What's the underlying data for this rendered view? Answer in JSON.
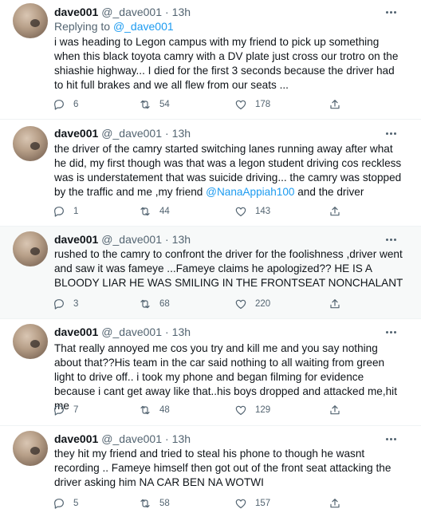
{
  "tweets": [
    {
      "name": "dave001",
      "handle": "@_dave001",
      "sep": "·",
      "time": "13h",
      "reply_prefix": "Replying to",
      "reply_to": "@_dave001",
      "text": "i was heading to Legon campus with my friend to pick up something when this black toyota camry with a DV plate just cross our trotro on the shiashie highway... I died for the first 3 seconds because the driver had to hit full brakes and we all flew from our seats ...",
      "replies": "6",
      "retweets": "54",
      "likes": "178"
    },
    {
      "name": "dave001",
      "handle": "@_dave001",
      "sep": "·",
      "time": "13h",
      "text": "the driver of the camry started switching lanes running away after what he did, my first though was that was a legon student driving cos reckless was is understatement that was suicide driving... the camry was stopped by the traffic and me ,my friend",
      "mention": "@NanaAppiah100",
      "text_after": " and the driver",
      "replies": "1",
      "retweets": "44",
      "likes": "143"
    },
    {
      "name": "dave001",
      "handle": "@_dave001",
      "sep": "·",
      "time": "13h",
      "text": "rushed to the camry to confront the driver for the foolishness ,driver went and saw it was fameye ...Fameye claims he apologized?? HE IS A BLOODY LIAR HE WAS SMILING IN THE FRONTSEAT NONCHALANT",
      "replies": "3",
      "retweets": "68",
      "likes": "220"
    },
    {
      "name": "dave001",
      "handle": "@_dave001",
      "sep": "·",
      "time": "13h",
      "text": "That really annoyed me cos you try and kill me and you say nothing about that??His team in the car said nothing to all waiting from green light to drive off.. i took my phone and began filming for evidence because i cant get away like that..his boys dropped and attacked me,hit me",
      "replies": "7",
      "retweets": "48",
      "likes": "129"
    },
    {
      "name": "dave001",
      "handle": "@_dave001",
      "sep": "·",
      "time": "13h",
      "text": "they hit my friend and tried to steal his phone to though he wasnt recording .. Fameye himself then got out of the front seat attacking the driver asking him NA CAR BEN NA WOTWI",
      "replies": "5",
      "retweets": "58",
      "likes": "157"
    }
  ],
  "colors": {
    "text": "#0f1419",
    "secondary": "#536471",
    "link": "#1d9bf0",
    "shaded_bg": "#f7f9f9"
  },
  "icons": [
    "more-icon",
    "reply-icon",
    "retweet-icon",
    "like-icon",
    "share-icon"
  ]
}
